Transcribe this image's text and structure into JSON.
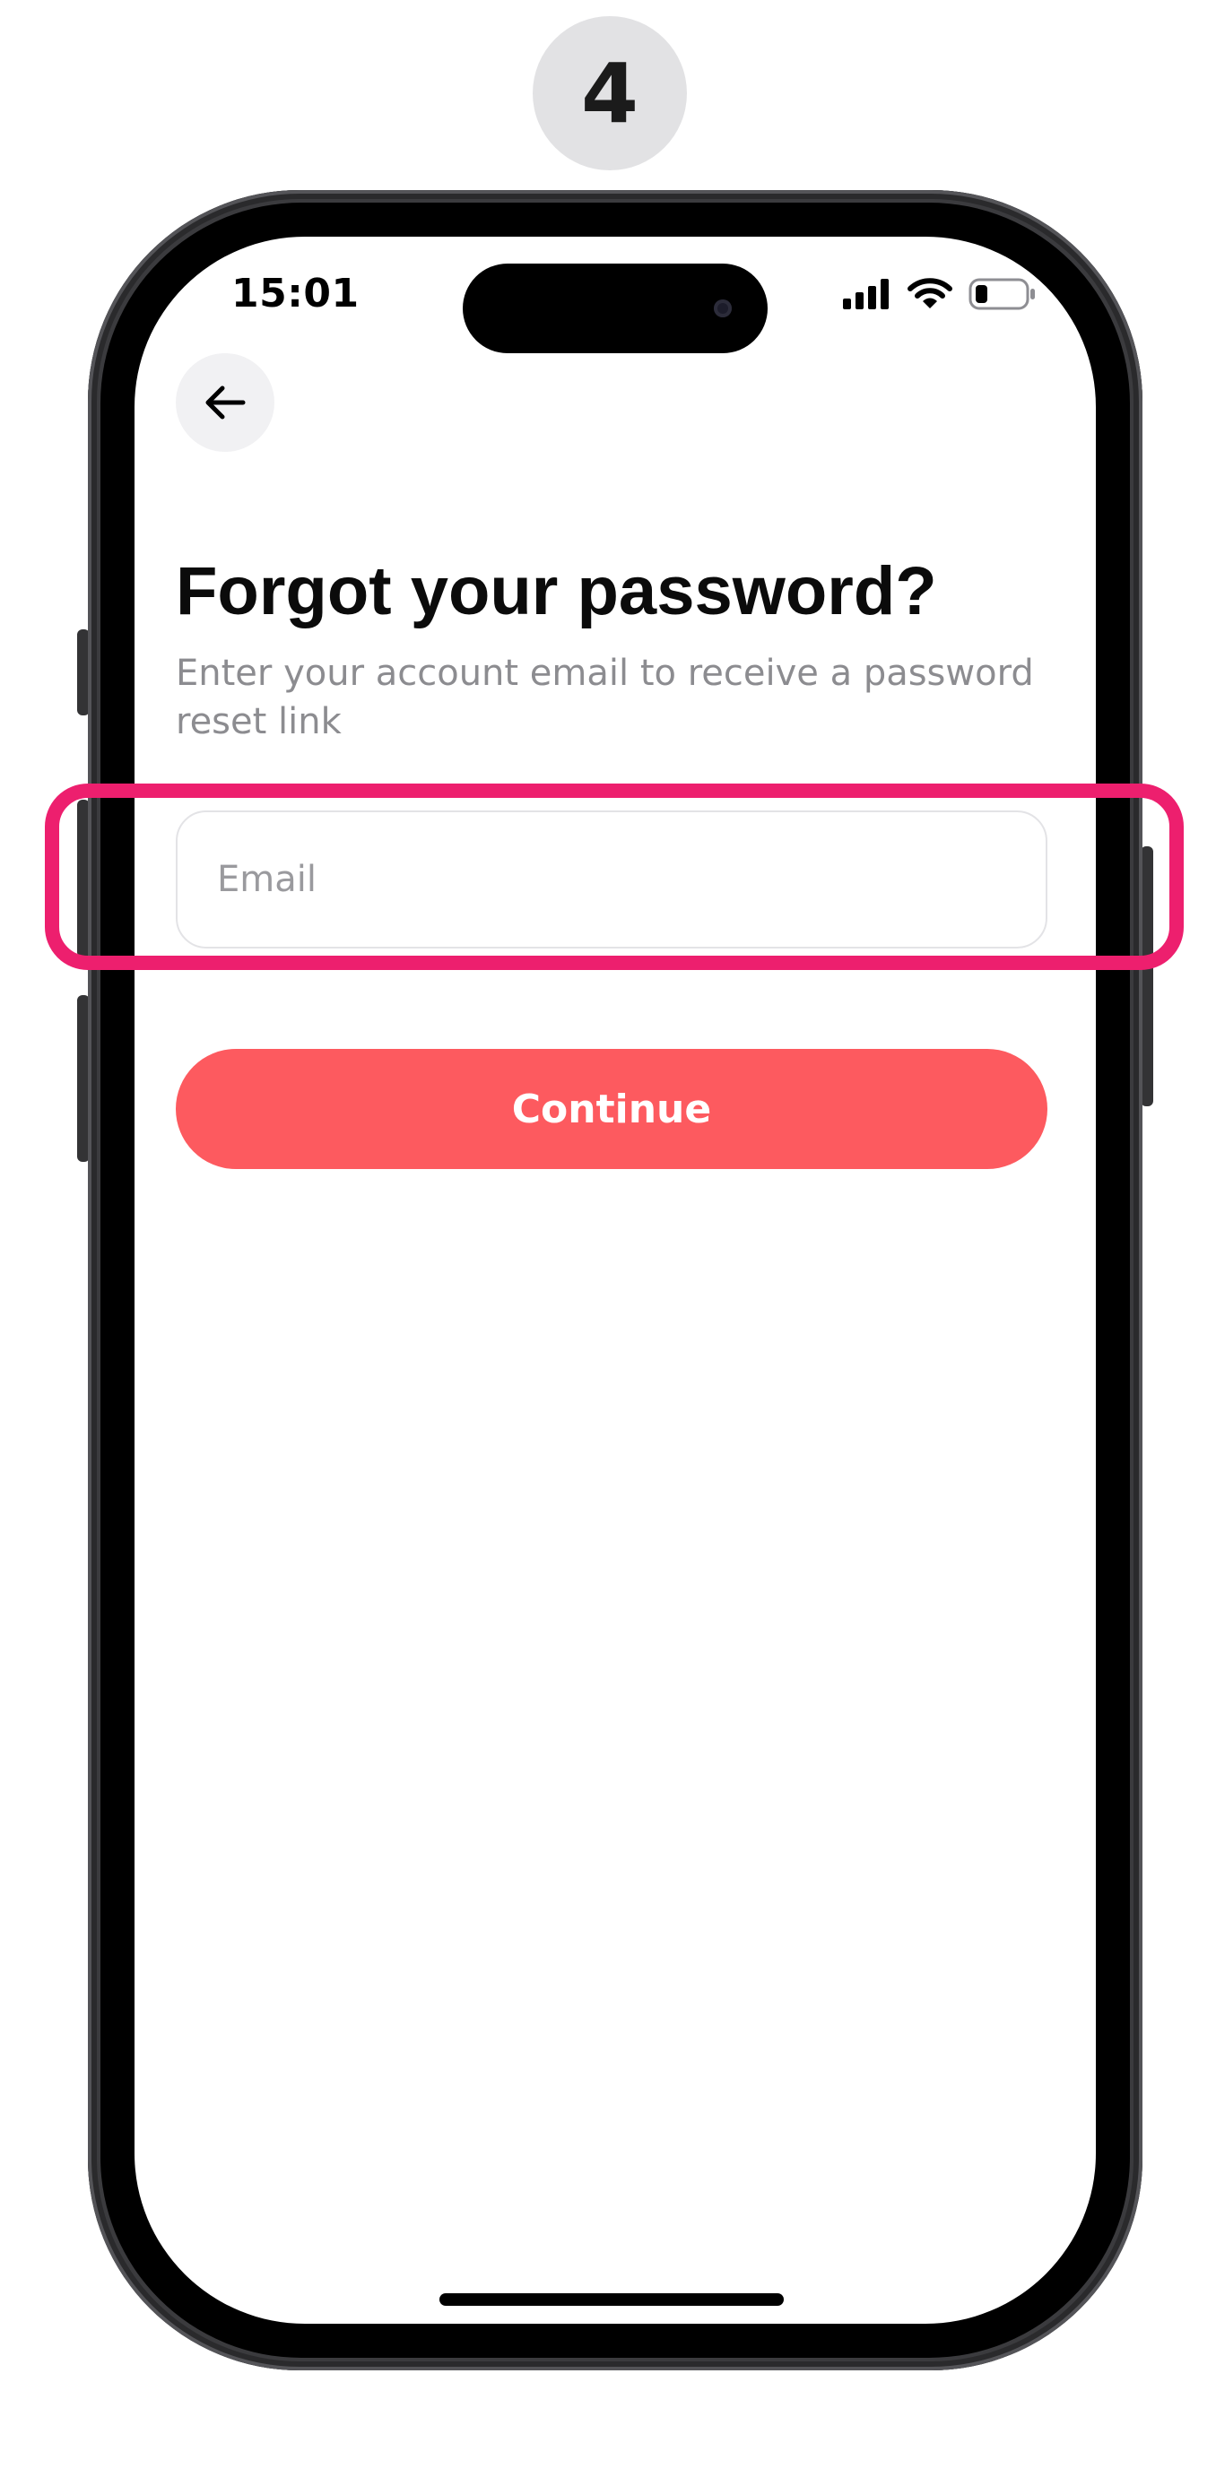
{
  "step": {
    "number": "4"
  },
  "status_bar": {
    "time": "15:01",
    "icons": [
      "signal-icon",
      "wifi-icon",
      "battery-icon"
    ]
  },
  "nav": {
    "back_icon": "arrow-left-icon"
  },
  "page": {
    "title": "Forgot your password?",
    "subtitle": "Enter your account email to receive a password reset link"
  },
  "form": {
    "email": {
      "value": "",
      "placeholder": "Email"
    },
    "continue_label": "Continue"
  },
  "colors": {
    "accent": "#fd5a5f",
    "highlight": "#ed1f6e",
    "badge": "#e2e2e4"
  }
}
